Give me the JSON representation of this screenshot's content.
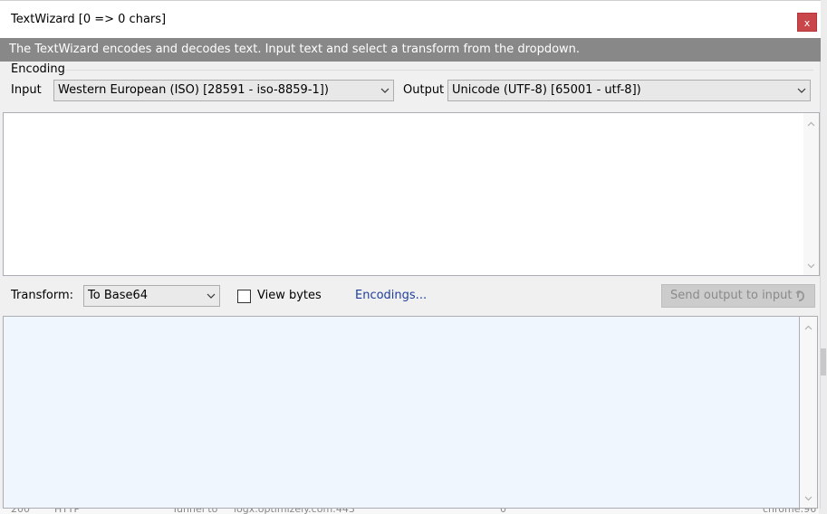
{
  "window": {
    "title": "TextWizard [0 => 0 chars]",
    "close_label": "x",
    "info": "The TextWizard encodes and decodes text. Input text and select a transform from the dropdown."
  },
  "encoding": {
    "section_label": "Encoding",
    "input_label": "Input",
    "input_value": "Western European (ISO) [28591 - iso-8859-1])",
    "output_label": "Output",
    "output_value": "Unicode (UTF-8) [65001 - utf-8])"
  },
  "input_text": "",
  "transform": {
    "label": "Transform:",
    "value": "To Base64",
    "view_bytes_label": "View bytes",
    "view_bytes_checked": false,
    "encodings_link": "Encodings...",
    "send_button": "Send output to input"
  },
  "output_text": "",
  "background_strip": {
    "c1": "200",
    "c2": "HTTP",
    "c3": "Tunnel to",
    "c4": "logx.optimizely.com:443",
    "c5": "0",
    "c6": "chrome:96"
  },
  "colors": {
    "info_bar": "#888888",
    "close_button": "#c9474b",
    "output_bg": "#f0f6fd",
    "link": "#1f3d9c"
  },
  "icons": {
    "dropdown": "chevron-down-icon",
    "scroll_up": "arrow-up-icon",
    "scroll_down": "arrow-down-icon",
    "send": "send-output-icon"
  }
}
